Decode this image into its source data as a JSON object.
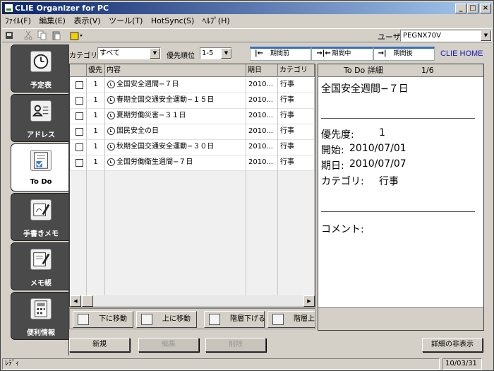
{
  "window": {
    "title": "CLIE Organizer for PC",
    "controls": [
      "_",
      "□",
      "×"
    ]
  },
  "menu": [
    "ﾌｧｲﾙ(F)",
    "編集(E)",
    "表示(V)",
    "ツール(T)",
    "HotSync(S)",
    "ﾍﾙﾌﾟ(H)"
  ],
  "toolbar": {
    "user_label": "ユーザ:",
    "user_value": "PEGNX70V"
  },
  "sidebar": [
    {
      "label": "予定表",
      "icon": "clock-icon"
    },
    {
      "label": "アドレス",
      "icon": "address-card-icon"
    },
    {
      "label": "To Do",
      "icon": "todo-checklist-icon"
    },
    {
      "label": "手書きメモ",
      "icon": "handwriting-memo-icon"
    },
    {
      "label": "メモ帳",
      "icon": "memo-pad-icon"
    },
    {
      "label": "便利情報",
      "icon": "calculator-icon"
    }
  ],
  "filters": {
    "category_label": "カテゴリ",
    "category_value": "すべて",
    "priority_label": "優先順位",
    "priority_value": "1-5"
  },
  "period": [
    {
      "arrow": "|←",
      "label": "期間前"
    },
    {
      "arrow": "→|←",
      "label": "期間中"
    },
    {
      "arrow": "→|",
      "label": "期間後"
    }
  ],
  "clie_home": "CLIE HOME",
  "table": {
    "headers": [
      "",
      "優先",
      "内容",
      "期日",
      "カテゴリ"
    ],
    "rows": [
      {
        "priority": "1",
        "content": "全国安全週間−７日",
        "due": "2010...",
        "category": "行事"
      },
      {
        "priority": "1",
        "content": "春期全国交通安全運動−１５日",
        "due": "2010...",
        "category": "行事"
      },
      {
        "priority": "1",
        "content": "夏期労働災害−３１日",
        "due": "2010...",
        "category": "行事"
      },
      {
        "priority": "1",
        "content": "国民安全の日",
        "due": "2010...",
        "category": "行事"
      },
      {
        "priority": "1",
        "content": "秋期全国交通安全運動−３０日",
        "due": "2010...",
        "category": "行事"
      },
      {
        "priority": "1",
        "content": "全国労働衛生週間−７日",
        "due": "2010...",
        "category": "行事"
      }
    ]
  },
  "move_buttons": [
    "下に移動",
    "上に移動",
    "階層下げる",
    "階層上"
  ],
  "detail": {
    "title": "To Do 詳細",
    "page": "1/6",
    "heading": "全国安全週間−７日",
    "priority_label": "優先度:",
    "priority": "1",
    "start_label": "開始:",
    "start": "2010/07/01",
    "due_label": "期日:",
    "due": "2010/07/07",
    "category_label": "カテゴリ:",
    "category": "行事",
    "comment_label": "コメント:"
  },
  "buttons": {
    "new": "新規",
    "edit": "編集",
    "delete": "削除",
    "hide_detail": "詳細の非表示"
  },
  "status": {
    "left": "ﾚﾃﾞｨ",
    "date": "10/03/31"
  }
}
